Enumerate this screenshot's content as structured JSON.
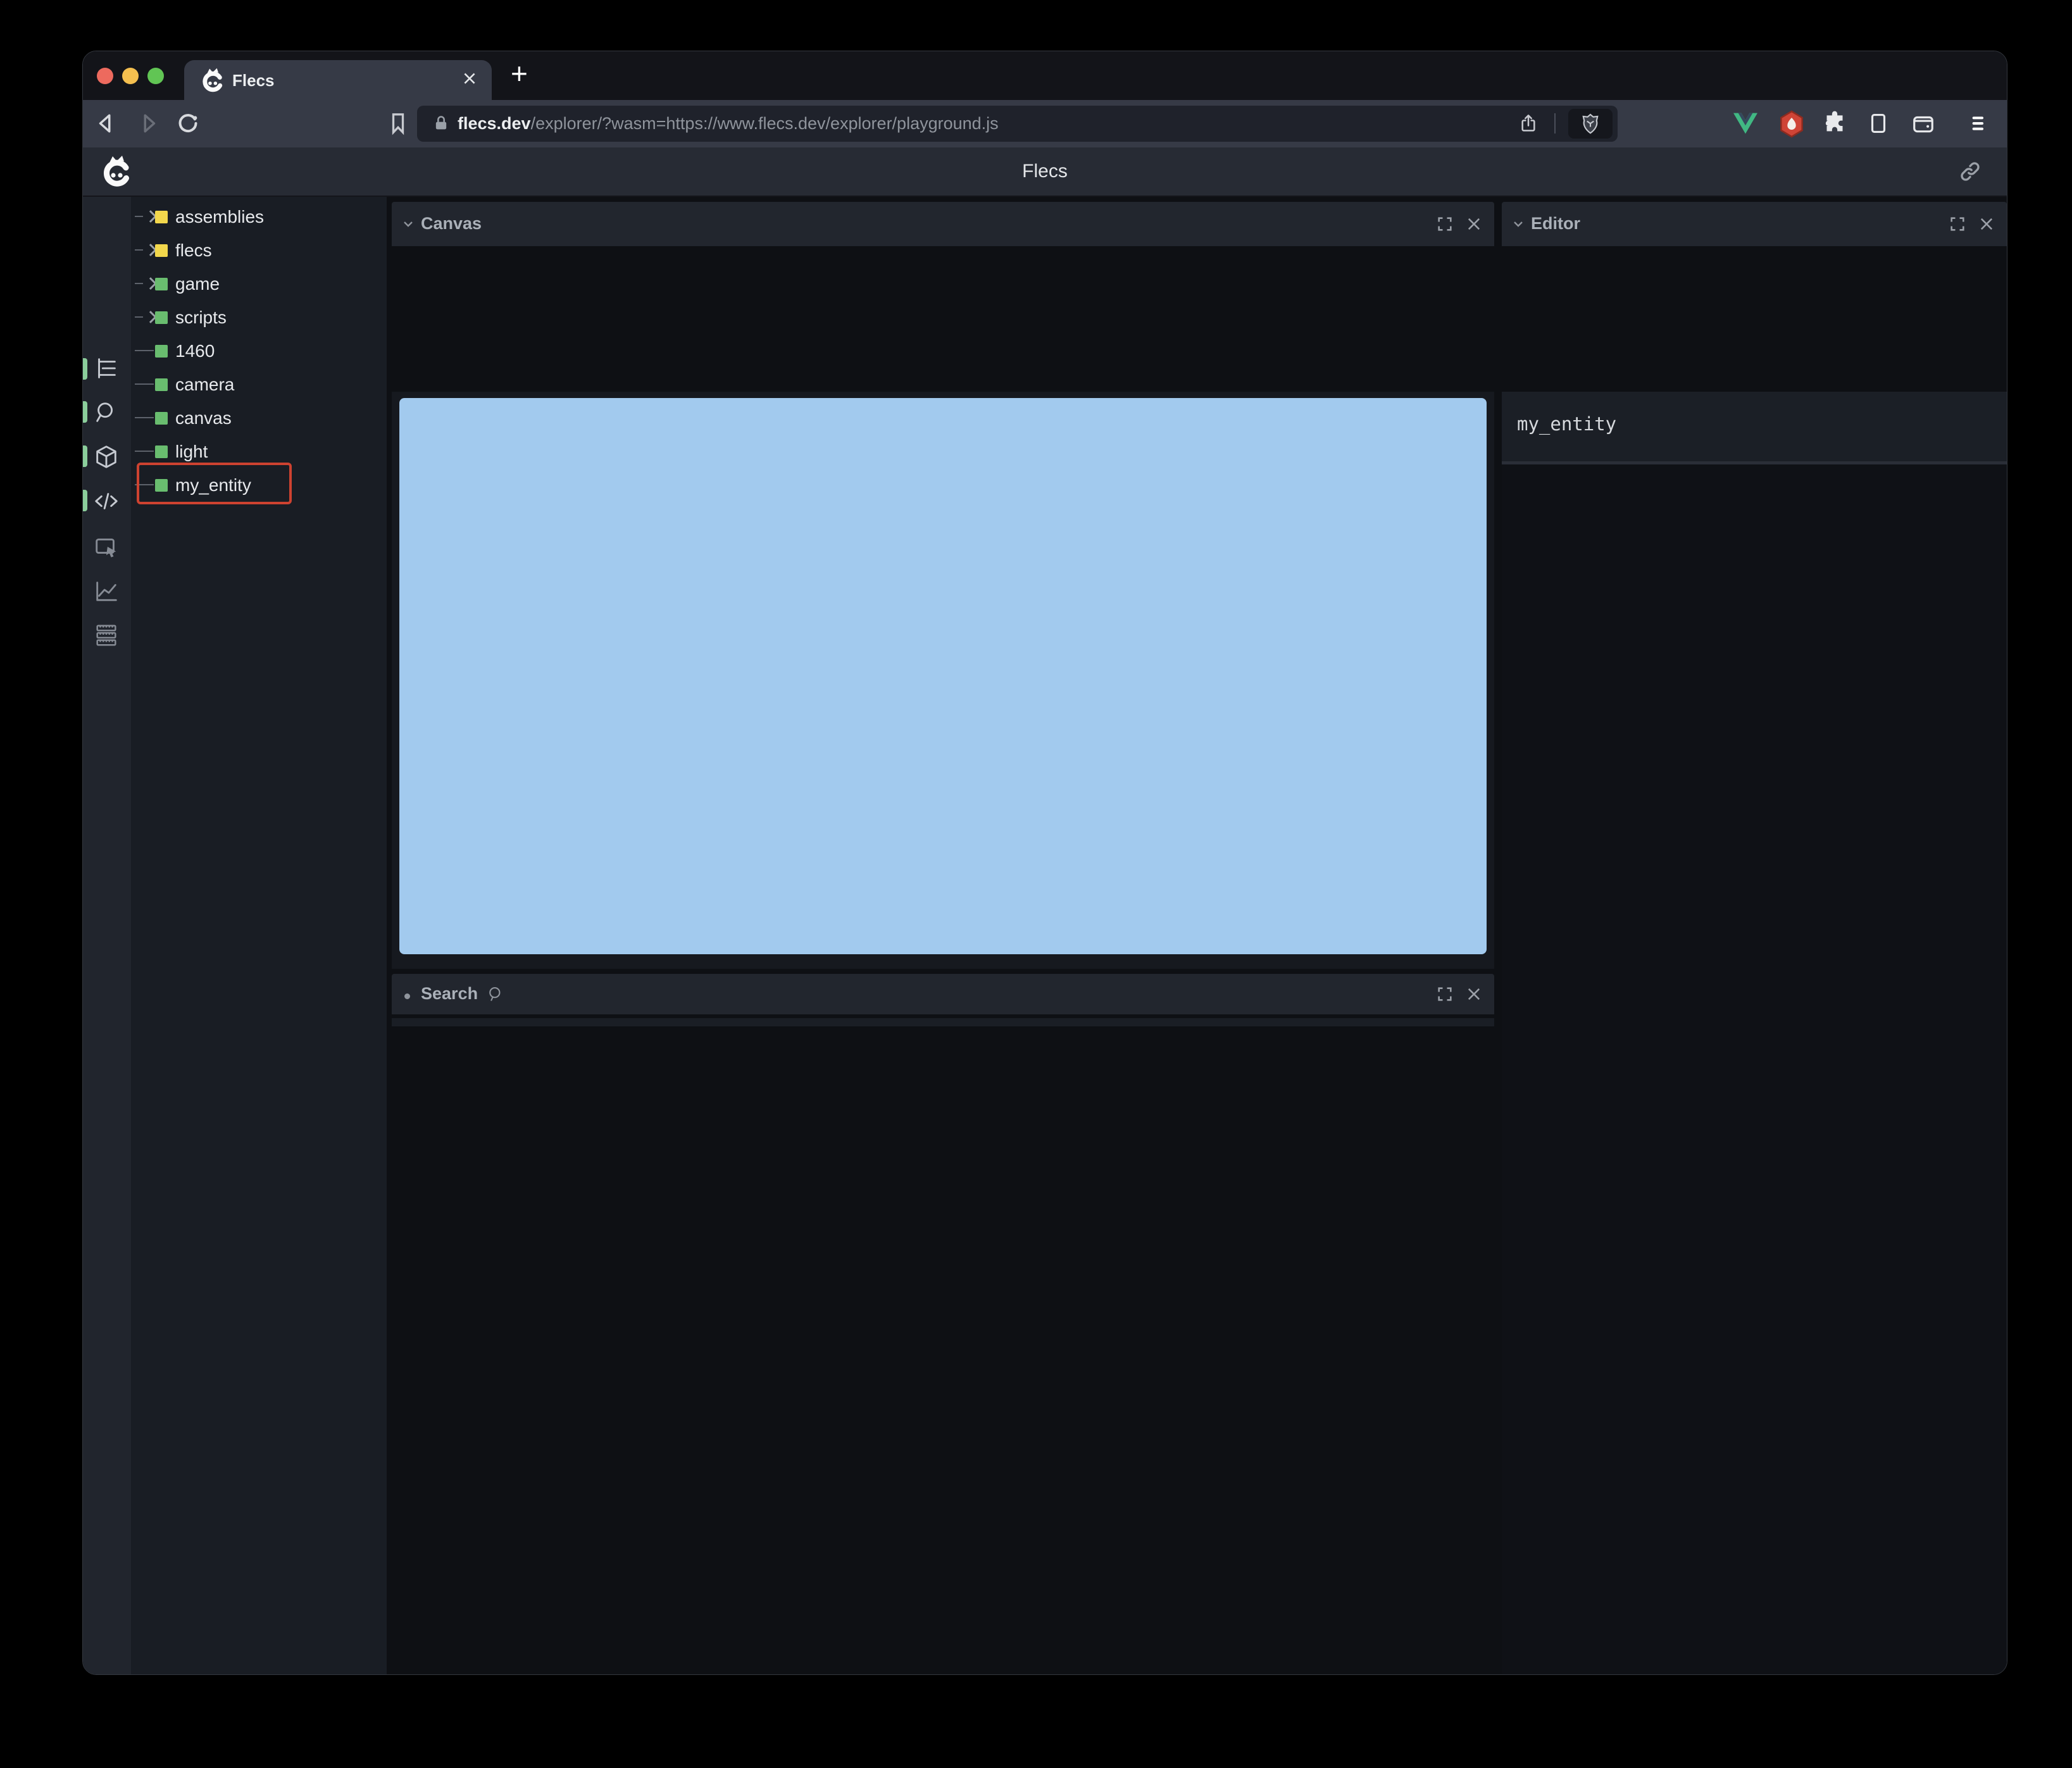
{
  "browser": {
    "tab": {
      "title": "Flecs",
      "close_glyph": "✕",
      "new_tab_glyph": "+"
    },
    "address": {
      "domain": "flecs.dev",
      "path": "/explorer/?wasm=https://www.flecs.dev/explorer/playground.js"
    },
    "toolbar_icons": [
      "back",
      "forward",
      "reload",
      "bookmark",
      "share",
      "brave-shields",
      "vue-devtools",
      "extension-hex",
      "extensions-puzzle",
      "side-panel",
      "wallet",
      "menu"
    ]
  },
  "app": {
    "header": {
      "title": "Flecs",
      "link_icon": "link"
    },
    "sidebar": {
      "icons": [
        {
          "name": "hierarchy",
          "active": true
        },
        {
          "name": "search",
          "active": true
        },
        {
          "name": "entities-cube",
          "active": true
        },
        {
          "name": "code",
          "active": true
        },
        {
          "name": "inspect",
          "active": false
        },
        {
          "name": "stats-chart",
          "active": false
        },
        {
          "name": "memory",
          "active": false
        }
      ]
    },
    "tree": {
      "items": [
        {
          "label": "assemblies",
          "color": "#f2d74c",
          "expandable": true
        },
        {
          "label": "flecs",
          "color": "#f2d74c",
          "expandable": true
        },
        {
          "label": "game",
          "color": "#69bd6f",
          "expandable": true
        },
        {
          "label": "scripts",
          "color": "#69bd6f",
          "expandable": true
        },
        {
          "label": "1460",
          "color": "#69bd6f",
          "expandable": false
        },
        {
          "label": "camera",
          "color": "#69bd6f",
          "expandable": false
        },
        {
          "label": "canvas",
          "color": "#69bd6f",
          "expandable": false
        },
        {
          "label": "light",
          "color": "#69bd6f",
          "expandable": false
        },
        {
          "label": "my_entity",
          "color": "#69bd6f",
          "expandable": false,
          "highlighted": true
        }
      ]
    },
    "canvas_panel": {
      "title": "Canvas",
      "canvas_color": "#a2caee"
    },
    "search_panel": {
      "title": "Search"
    },
    "editor_panel": {
      "title": "Editor",
      "content": "my_entity"
    }
  },
  "colors": {
    "highlight_red": "#cd4230",
    "accent_green": "#69bd6f",
    "accent_yellow": "#f2d74c",
    "canvas_blue": "#a2caee",
    "pill_green": "#8bce9b"
  }
}
